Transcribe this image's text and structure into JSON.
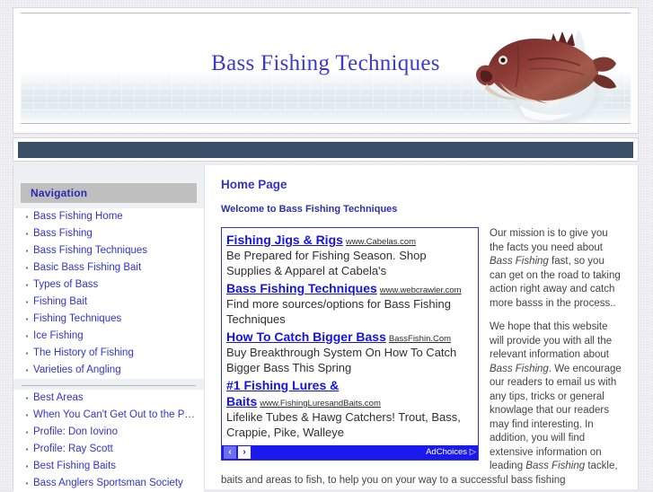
{
  "site": {
    "title": "Bass Fishing Techniques",
    "header_image": "largemouth-bass-illustration"
  },
  "sidebar": {
    "heading": "Navigation",
    "primary_items": [
      {
        "label": "Bass Fishing Home"
      },
      {
        "label": "Bass Fishing"
      },
      {
        "label": "Bass Fishing Techniques"
      },
      {
        "label": "Basic Bass Fishing Bait"
      },
      {
        "label": "Types of Bass"
      },
      {
        "label": "Fishing Bait"
      },
      {
        "label": "Fishing Techniques"
      },
      {
        "label": "Ice Fishing"
      },
      {
        "label": "The History of Fishing"
      },
      {
        "label": "Varieties of Angling"
      }
    ],
    "secondary_items": [
      {
        "label": "Best Areas"
      },
      {
        "label": "When You Can't Get Out to the Pond..."
      },
      {
        "label": "Profile: Don Iovino"
      },
      {
        "label": "Profile: Ray Scott"
      },
      {
        "label": "Best Fishing Baits"
      },
      {
        "label": "Bass Anglers Sportsman Society"
      }
    ]
  },
  "main": {
    "page_title": "Home Page",
    "welcome": "Welcome to Bass Fishing Techniques",
    "paragraph_1_a": "Our mission is to give you the facts you need about ",
    "paragraph_1_em": "Bass Fishing",
    "paragraph_1_b": " fast, so you can get on the road to taking action right away and catch more basss in the process..",
    "paragraph_2_a": "We hope that this website will provide you with all the relevant information about ",
    "paragraph_2_em": "Bass Fishing",
    "paragraph_2_b": ". We encourage our readers to email us with any tips, tricks or general knowlage that our readers may find interesting. In addition, you will find extensive information on leading ",
    "paragraph_2_em2": "Bass Fishing",
    "paragraph_2_c": " tackle, baits and areas to fish, to help you on your way to a successful bass fishing"
  },
  "ad_unit": {
    "ads": [
      {
        "headline": "Fishing Jigs & Rigs",
        "url": "www.Cabelas.com",
        "description": "Be Prepared for Fishing Season. Shop Supplies & Apparel at Cabela's"
      },
      {
        "headline": "Bass Fishing Techniques",
        "url": "www.webcrawler.com",
        "description": "Find more sources/options for Bass Fishing Techniques"
      },
      {
        "headline": "How To Catch Bigger Bass",
        "url": "BassFishin.Com",
        "description": "Buy Breakthrough System On How To Catch Bigger Bass This Spring"
      },
      {
        "headline": "#1 Fishing Lures & Baits",
        "url": "www.FishingLuresandBaits.com",
        "description": "Lifelike Tubes & Hawg Catchers! Trout, Bass, Crappie, Pike, Walleye"
      }
    ],
    "prev_arrow": "‹",
    "next_arrow": "›",
    "adchoices_label": "AdChoices",
    "adchoices_icon": "▷"
  },
  "colors": {
    "title_blue": "#3b3bc9",
    "navy_bar": "#3c4f68",
    "link_blue": "#3333cc",
    "ad_blue": "#1a1aee",
    "nav_head_gray": "#bfbfbf",
    "sidebar_bg": "#eef1f4"
  }
}
